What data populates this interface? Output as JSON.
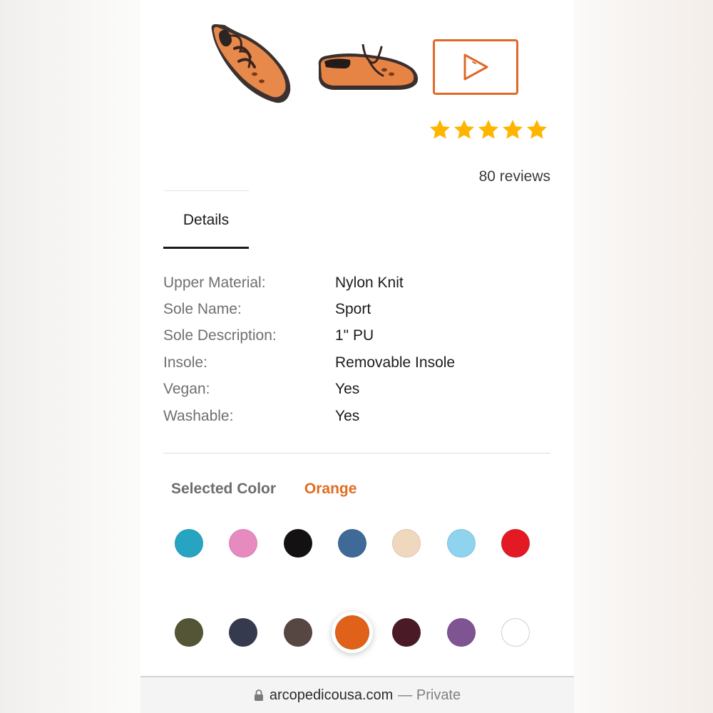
{
  "product": {
    "rating": {
      "value": 5,
      "max": 5
    },
    "reviews_label": "80 reviews",
    "accent_color": "#e0692a",
    "star_color": "#ffb400"
  },
  "tabs": [
    {
      "label": "Details"
    }
  ],
  "details": [
    {
      "label": "Upper Material:",
      "value": "Nylon Knit"
    },
    {
      "label": "Sole Name:",
      "value": "Sport"
    },
    {
      "label": "Sole Description:",
      "value": "1\" PU"
    },
    {
      "label": "Insole:",
      "value": "Removable Insole"
    },
    {
      "label": "Vegan:",
      "value": "Yes"
    },
    {
      "label": "Washable:",
      "value": "Yes"
    }
  ],
  "color_selector": {
    "label": "Selected Color",
    "value": "Orange",
    "swatches": [
      {
        "name": "teal",
        "hex": "#26a4c1"
      },
      {
        "name": "pink",
        "hex": "#e68ac0"
      },
      {
        "name": "black",
        "hex": "#141112"
      },
      {
        "name": "blue",
        "hex": "#3f6a98"
      },
      {
        "name": "beige",
        "hex": "#f0d8bf"
      },
      {
        "name": "light-blue",
        "hex": "#8fd3ee"
      },
      {
        "name": "red",
        "hex": "#e31a24"
      },
      {
        "name": "olive",
        "hex": "#545536"
      },
      {
        "name": "navy",
        "hex": "#363a4e"
      },
      {
        "name": "brown",
        "hex": "#574743"
      },
      {
        "name": "orange",
        "hex": "#e0621a",
        "selected": true
      },
      {
        "name": "burgundy",
        "hex": "#4a1b27"
      },
      {
        "name": "purple",
        "hex": "#7e5492"
      },
      {
        "name": "white",
        "hex": "#ffffff"
      }
    ]
  },
  "browser": {
    "domain": "arcopedicousa.com",
    "privacy": "— Private"
  }
}
